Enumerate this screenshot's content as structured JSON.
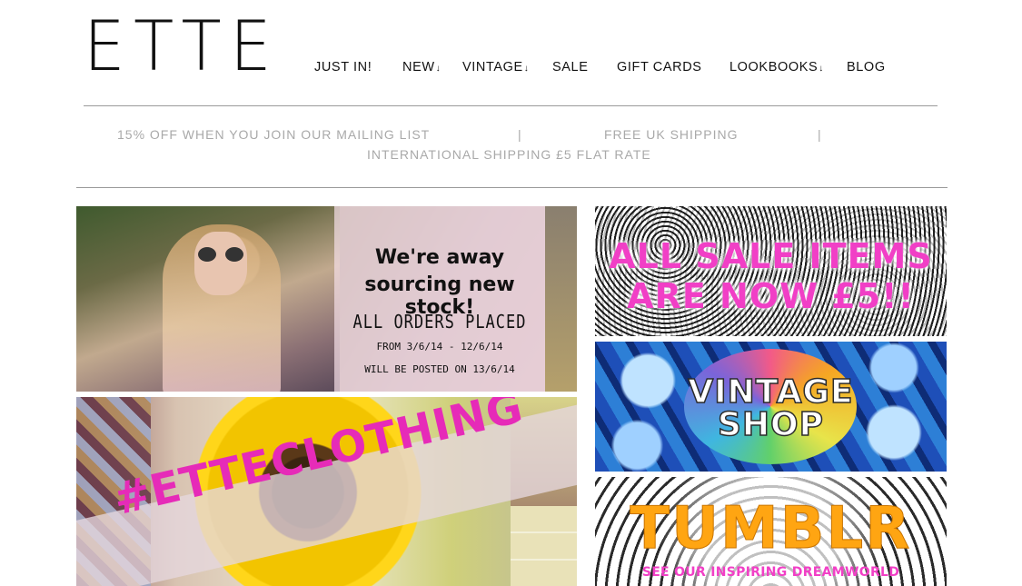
{
  "header": {
    "logo": "ETTE"
  },
  "nav": {
    "items": [
      {
        "label": "JUST IN!",
        "arrow": ""
      },
      {
        "label": "NEW",
        "arrow": "↓"
      },
      {
        "label": "VINTAGE",
        "arrow": "↓"
      },
      {
        "label": "SALE",
        "arrow": ""
      },
      {
        "label": "GIFT CARDS",
        "arrow": ""
      },
      {
        "label": "LOOKBOOKS",
        "arrow": "↓"
      },
      {
        "label": "BLOG",
        "arrow": ""
      }
    ]
  },
  "promo": {
    "mailing": "15% OFF WHEN YOU JOIN OUR MAILING LIST",
    "sep": "|",
    "shipping": "FREE UK SHIPPING",
    "international": "INTERNATIONAL SHIPPING £5 FLAT RATE"
  },
  "banners": {
    "away": {
      "line1": "We're away",
      "line2": "sourcing new stock!",
      "line3": "ALL ORDERS PLACED",
      "line4": "FROM 3/6/14 - 12/6/14",
      "line5": "WILL BE POSTED ON 13/6/14"
    },
    "hashtag": "#ETTECLOTHING",
    "sale": {
      "line1": "ALL SALE ITEMS",
      "line2": "ARE NOW £5!!"
    },
    "vintage": {
      "line1": "VINTAGE",
      "line2": "SHOP"
    },
    "tumblr": {
      "title": "TUMBLR",
      "sub": "SEE OUR INSPIRING DREAMWORLD"
    }
  },
  "colors": {
    "pink": "#f13fc6",
    "orange": "#ffa512",
    "promo_gray": "#a9a9a9"
  }
}
